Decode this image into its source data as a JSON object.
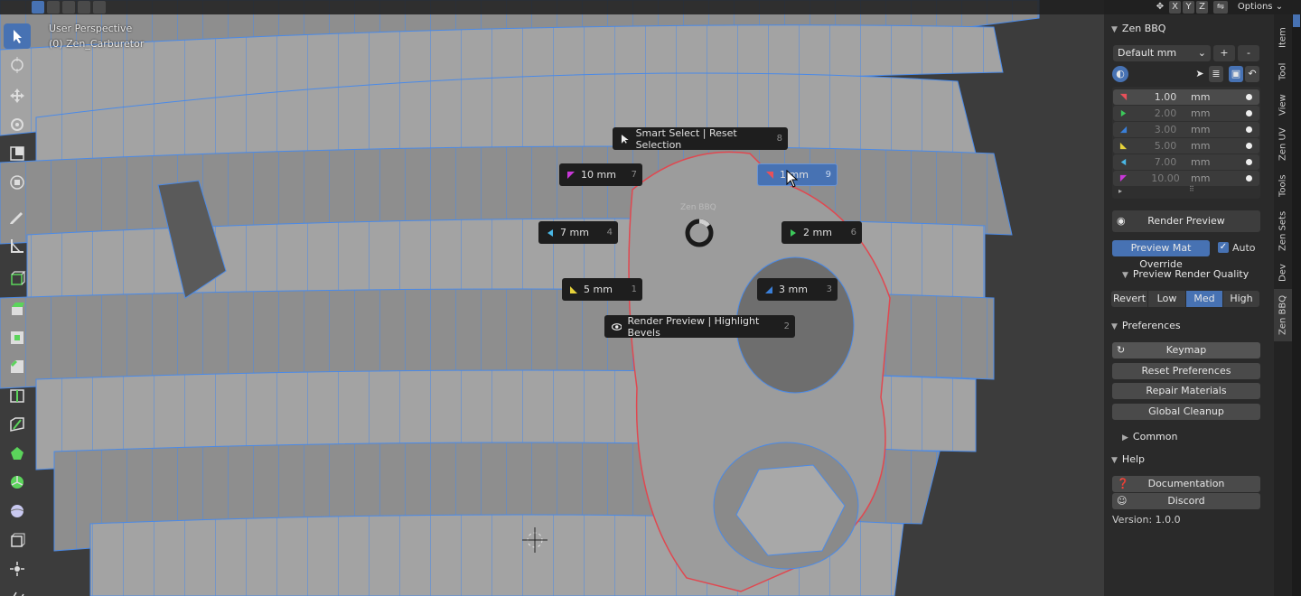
{
  "viewport": {
    "perspective_label": "User Perspective",
    "object_label": "(0) Zen_Carburetor",
    "zen_bbq_label": "Zen BBQ"
  },
  "header": {
    "axis_buttons": [
      "X",
      "Y",
      "Z"
    ],
    "options_label": "Options"
  },
  "pie_menu": {
    "top": {
      "label": "Smart Select | Reset Selection",
      "num": "8"
    },
    "top_left": {
      "label": "10 mm",
      "num": "7"
    },
    "top_right": {
      "label": "1 mm",
      "num": "9"
    },
    "left": {
      "label": "7 mm",
      "num": "4"
    },
    "right": {
      "label": "2 mm",
      "num": "6"
    },
    "bottom_left": {
      "label": "5 mm",
      "num": "1"
    },
    "bottom_right": {
      "label": "3 mm",
      "num": "3"
    },
    "bottom": {
      "label": "Render Preview | Highlight Bevels",
      "num": "2"
    }
  },
  "sidebar": {
    "panel_title": "Zen BBQ",
    "preset_select": "Default mm",
    "add_btn": "+",
    "remove_btn": "-",
    "bevel_rows": [
      {
        "value": "1.00",
        "unit": "mm",
        "color": "#e8505a"
      },
      {
        "value": "2.00",
        "unit": "mm",
        "color": "#3cc85a"
      },
      {
        "value": "3.00",
        "unit": "mm",
        "color": "#3a7fd8"
      },
      {
        "value": "5.00",
        "unit": "mm",
        "color": "#e6d23a"
      },
      {
        "value": "7.00",
        "unit": "mm",
        "color": "#4ab8e6"
      },
      {
        "value": "10.00",
        "unit": "mm",
        "color": "#c838d8"
      }
    ],
    "render_preview": "Render Preview",
    "preview_mat_override": "Preview Mat Override",
    "auto_label": "Auto",
    "preview_render_quality": "Preview Render Quality",
    "quality_options": [
      "Revert",
      "Low",
      "Med",
      "High"
    ],
    "quality_selected": "Med",
    "preferences_title": "Preferences",
    "keymap": "Keymap",
    "reset_preferences": "Reset Preferences",
    "repair_materials": "Repair Materials",
    "global_cleanup": "Global Cleanup",
    "common_title": "Common",
    "help_title": "Help",
    "documentation": "Documentation",
    "discord": "Discord",
    "version": "Version: 1.0.0"
  },
  "tabs": [
    "Item",
    "Tool",
    "View",
    "Zen UV",
    "Tools",
    "Zen Sets",
    "Dev",
    "Zen BBQ"
  ],
  "colors": {
    "accent": "#4772b3",
    "mesh_wire": "#4a8ae8",
    "bevel_edge": "#e04850"
  }
}
